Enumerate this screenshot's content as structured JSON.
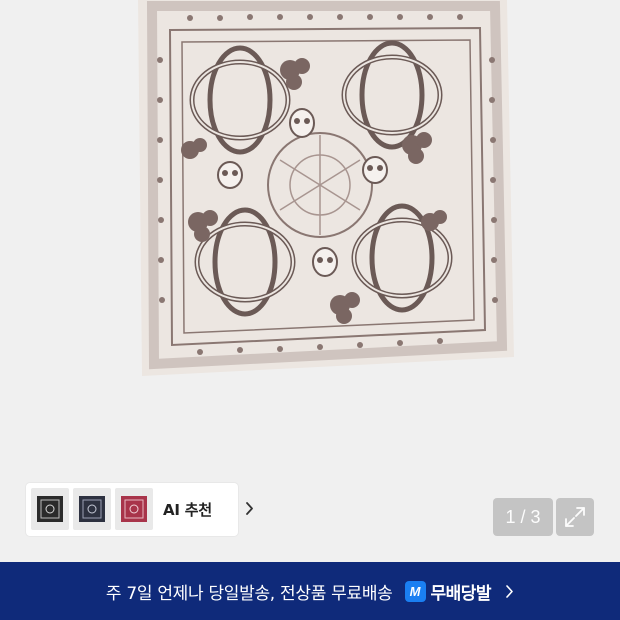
{
  "product": {
    "image_icon": "bandana-scarf-image",
    "colors": {
      "fabric": "#ece6e1",
      "print": "#6b5a56",
      "border": "#d9cfca"
    }
  },
  "ai_recommend": {
    "label": "AI 추천",
    "thumbnails": [
      {
        "name": "black-bandana",
        "color": "#2b2b2b"
      },
      {
        "name": "navy-bandana",
        "color": "#2d3140"
      },
      {
        "name": "red-bandana",
        "color": "#a8344a"
      }
    ]
  },
  "pager": {
    "counter": "1 / 3",
    "expand_icon": "expand-arrows-icon"
  },
  "banner": {
    "text": "주 7일 언제나 당일발송, 전상품 무료배송",
    "brand_mark": "M",
    "brand_name": "무배당발",
    "background": "#0f2a7a",
    "brand_color": "#1a7ff2"
  }
}
